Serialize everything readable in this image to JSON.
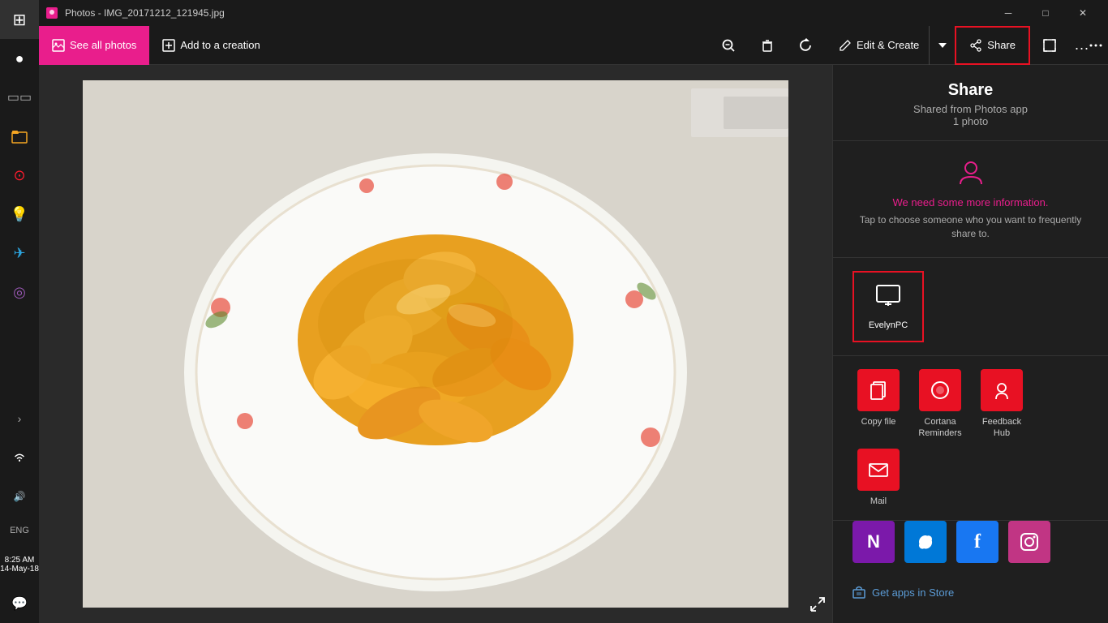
{
  "window": {
    "title": "Photos - IMG_20171212_121945.jpg",
    "min_label": "minimize",
    "max_label": "maximize",
    "close_label": "close"
  },
  "toolbar": {
    "see_all_photos": "See all photos",
    "add_to_creation": "Add to a creation",
    "edit_create": "Edit & Create",
    "share": "Share",
    "more_options": "..."
  },
  "share_panel": {
    "title": "Share",
    "subtitle": "Shared from Photos app",
    "count": "1 photo",
    "contact_message": "We need some more information.",
    "contact_desc": "Tap to choose someone who you want to frequently share to.",
    "device_label": "EvelynPC",
    "apps": [
      {
        "label": "Copy file",
        "color": "#e81123",
        "icon": "📋"
      },
      {
        "label": "Cortana Reminders",
        "color": "#e81123",
        "icon": "⭕"
      },
      {
        "label": "Feedback Hub",
        "color": "#e81123",
        "icon": "👤"
      },
      {
        "label": "Mail",
        "color": "#e81123",
        "icon": "✉️"
      }
    ],
    "apps2": [
      {
        "label": "OneNote",
        "color": "#7719aa",
        "icon": "N"
      },
      {
        "label": "Skype",
        "color": "#0078d4",
        "icon": "S"
      },
      {
        "label": "Facebook",
        "color": "#1877f2",
        "icon": "f"
      },
      {
        "label": "Instagram",
        "color": "#c13584",
        "icon": "📷"
      }
    ],
    "get_apps": "Get apps in Store"
  },
  "sidebar": {
    "items": [
      {
        "icon": "⊞",
        "label": "start"
      },
      {
        "icon": "◯",
        "label": "search"
      },
      {
        "icon": "📁",
        "label": "files"
      },
      {
        "icon": "◯",
        "label": "opera"
      },
      {
        "icon": "💡",
        "label": "tips"
      },
      {
        "icon": "T",
        "label": "telegram"
      },
      {
        "icon": "◎",
        "label": "app6"
      },
      {
        "icon": "🖼",
        "label": "photos"
      }
    ]
  },
  "statusbar": {
    "time": "8:25 AM",
    "date": "14-May-18",
    "lang": "ENG"
  }
}
